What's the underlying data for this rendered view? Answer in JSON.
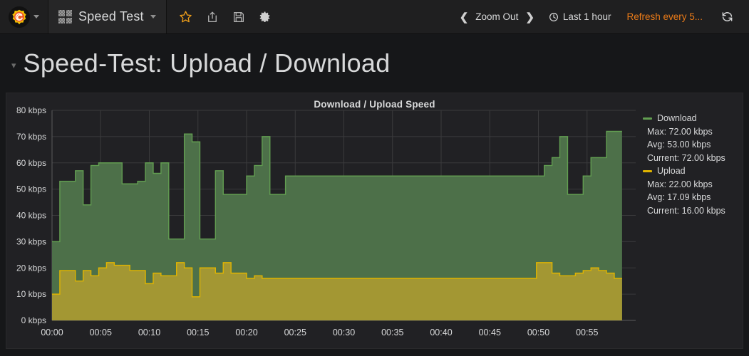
{
  "topnav": {
    "logo_icon": "grafana-logo-icon",
    "logo_caret_icon": "caret-down-icon",
    "dashboard_icon": "dashboard-grid-icon",
    "dashboard_name": "Speed Test",
    "dashboard_caret_icon": "caret-down-icon",
    "star_icon": "star-icon",
    "share_icon": "share-icon",
    "save_icon": "save-icon",
    "settings_icon": "gear-icon",
    "zoom_out_prev_icon": "chevron-left-icon",
    "zoom_out_label": "Zoom Out",
    "zoom_out_next_icon": "chevron-right-icon",
    "time_clock_icon": "clock-icon",
    "time_range": "Last 1 hour",
    "refresh_interval": "Refresh every 5...",
    "refresh_icon": "refresh-icon",
    "refresh_color": "#eb7b18"
  },
  "row": {
    "collapse_icon": "chevron-down-icon",
    "title": "Speed-Test: Upload / Download"
  },
  "panel": {
    "title": "Download / Upload Speed",
    "legend": [
      {
        "name": "Download",
        "color": "#629e51",
        "stats": [
          "Max: 72.00 kbps",
          "Avg: 53.00 kbps",
          "Current: 72.00 kbps"
        ]
      },
      {
        "name": "Upload",
        "color": "#e0b400",
        "stats": [
          "Max: 22.00 kbps",
          "Avg: 17.09 kbps",
          "Current: 16.00 kbps"
        ]
      }
    ]
  },
  "chart_data": {
    "type": "area",
    "title": "Download / Upload Speed",
    "xlabel": "",
    "ylabel": "",
    "unit": "kbps",
    "grid": true,
    "legend_position": "right",
    "line_interpolation": "step",
    "stacked": false,
    "xlim": [
      0,
      60
    ],
    "ylim": [
      0,
      80
    ],
    "ytick_labels": [
      "0 kbps",
      "10 kbps",
      "20 kbps",
      "30 kbps",
      "40 kbps",
      "50 kbps",
      "60 kbps",
      "70 kbps",
      "80 kbps"
    ],
    "ytick_values": [
      0,
      10,
      20,
      30,
      40,
      50,
      60,
      70,
      80
    ],
    "xtick_labels": [
      "00:00",
      "00:05",
      "00:10",
      "00:15",
      "00:20",
      "00:25",
      "00:30",
      "00:35",
      "00:40",
      "00:45",
      "00:50",
      "00:55"
    ],
    "xtick_values": [
      0,
      5,
      10,
      15,
      20,
      25,
      30,
      35,
      40,
      45,
      50,
      55
    ],
    "data_gap": [
      24.5,
      49.8
    ],
    "series": [
      {
        "name": "Download",
        "color": "#629e51",
        "fill_color": "#4d7049",
        "x": [
          0,
          0.8,
          1.6,
          2.4,
          3.2,
          4.0,
          4.8,
          5.6,
          6.4,
          7.2,
          8.0,
          8.8,
          9.6,
          10.4,
          11.2,
          12.0,
          12.8,
          13.6,
          14.4,
          15.2,
          16.0,
          16.8,
          17.6,
          18.4,
          19.2,
          20.0,
          20.8,
          21.6,
          22.4,
          23.2,
          24.0,
          49.8,
          50.6,
          51.4,
          52.2,
          53.0,
          53.8,
          54.6,
          55.4,
          56.2,
          57.0,
          57.8
        ],
        "values": [
          30,
          53,
          53,
          57,
          44,
          59,
          60,
          60,
          60,
          52,
          52,
          53,
          60,
          56,
          60,
          31,
          31,
          71,
          68,
          31,
          31,
          57,
          48,
          48,
          48,
          55,
          59,
          70,
          48,
          48,
          55,
          55,
          59,
          62,
          70,
          48,
          48,
          55,
          62,
          62,
          72,
          72
        ],
        "max": 72.0,
        "avg": 53.0,
        "current": 72.0
      },
      {
        "name": "Upload",
        "color": "#e0b400",
        "fill_color": "#a39733",
        "x": [
          0,
          0.8,
          1.6,
          2.4,
          3.2,
          4.0,
          4.8,
          5.6,
          6.4,
          7.2,
          8.0,
          8.8,
          9.6,
          10.4,
          11.2,
          12.0,
          12.8,
          13.6,
          14.4,
          15.2,
          16.0,
          16.8,
          17.6,
          18.4,
          19.2,
          20.0,
          20.8,
          21.6,
          22.4,
          23.2,
          24.0,
          49.8,
          50.6,
          51.4,
          52.2,
          53.0,
          53.8,
          54.6,
          55.4,
          56.2,
          57.0,
          57.8
        ],
        "values": [
          10,
          19,
          19,
          15,
          19,
          17,
          20,
          22,
          21,
          21,
          19,
          19,
          14,
          18,
          17,
          17,
          22,
          20,
          9,
          20,
          20,
          18,
          22,
          18,
          18,
          16,
          17,
          16,
          16,
          16,
          16,
          22,
          22,
          18,
          17,
          17,
          18,
          19,
          20,
          19,
          18,
          16
        ],
        "max": 22.0,
        "avg": 17.09,
        "current": 16.0
      }
    ]
  }
}
